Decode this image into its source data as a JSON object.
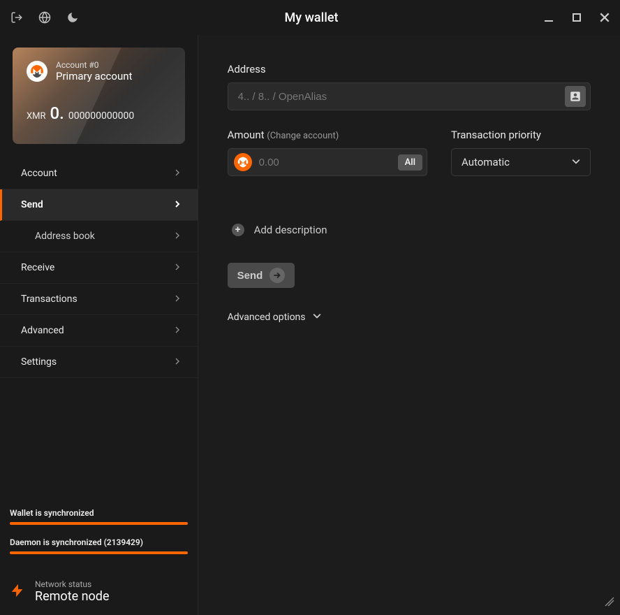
{
  "titlebar": {
    "title": "My wallet"
  },
  "account_card": {
    "account_num": "Account #0",
    "account_name": "Primary account",
    "currency": "XMR",
    "balance_left": "0.",
    "balance_right": "000000000000"
  },
  "nav": {
    "account": "Account",
    "send": "Send",
    "address_book": "Address book",
    "receive": "Receive",
    "transactions": "Transactions",
    "advanced": "Advanced",
    "settings": "Settings"
  },
  "sync": {
    "wallet": "Wallet is synchronized",
    "daemon": "Daemon is synchronized (2139429)"
  },
  "network": {
    "label": "Network status",
    "value": "Remote node"
  },
  "form": {
    "address_label": "Address",
    "address_placeholder": "4.. / 8.. / OpenAlias",
    "amount_label": "Amount",
    "amount_hint": "(Change account)",
    "amount_placeholder": "0.00",
    "all_btn": "All",
    "priority_label": "Transaction priority",
    "priority_value": "Automatic",
    "add_desc": "Add description",
    "send_btn": "Send",
    "adv_options": "Advanced options"
  }
}
